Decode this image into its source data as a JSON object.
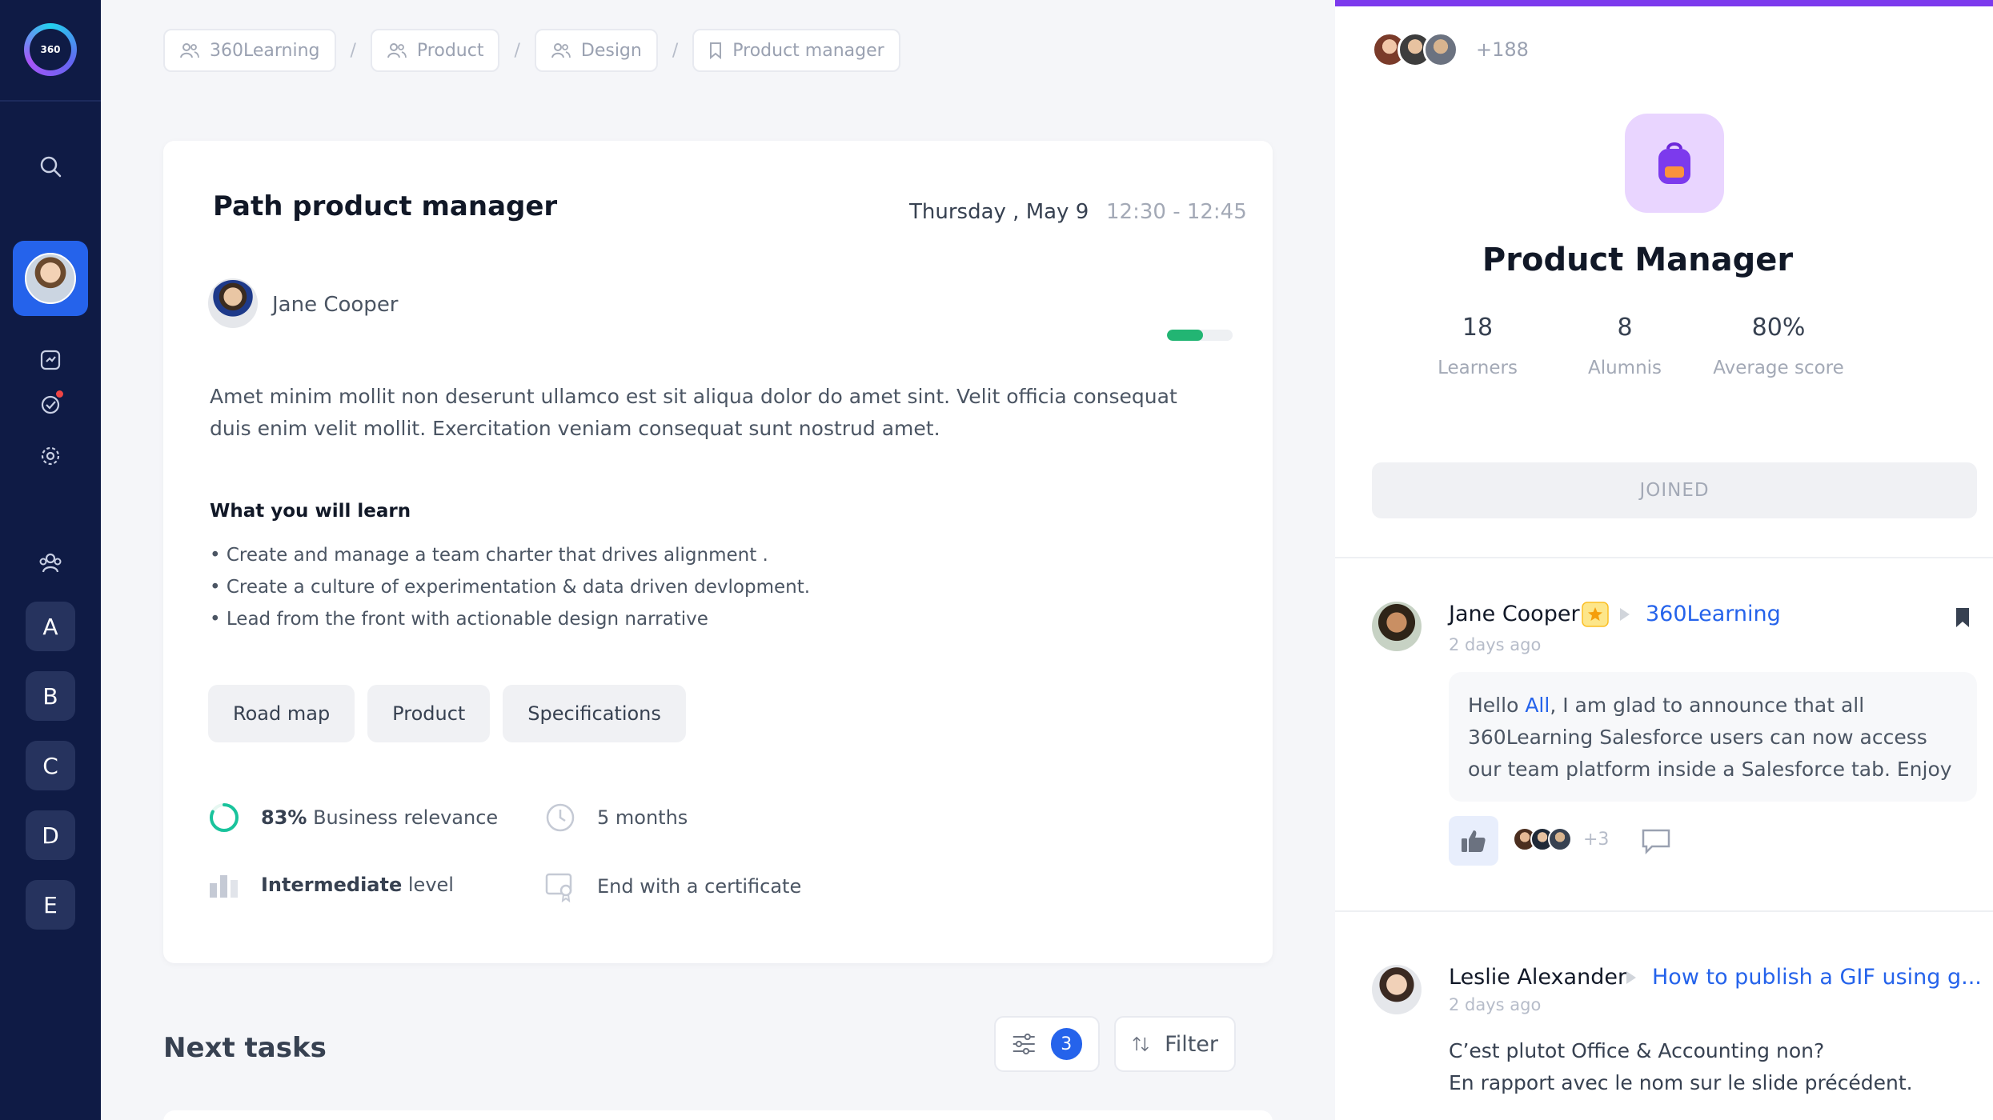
{
  "sidebar": {
    "logo_text": "360",
    "letters": [
      "A",
      "B",
      "C",
      "D",
      "E"
    ]
  },
  "breadcrumb": [
    "360Learning",
    "Product",
    "Design",
    "Product manager"
  ],
  "card": {
    "title": "Path product manager",
    "date": "Thursday , May 9",
    "time": "12:30 - 12:45",
    "author": "Jane Cooper",
    "progress": 0.55,
    "description": "Amet minim mollit non deserunt ullamco est sit aliqua dolor do amet sint. Velit officia consequat duis enim velit mollit. Exercitation veniam consequat sunt nostrud amet.",
    "learn_title": "What you will learn",
    "learn_items": [
      "• Create and manage a team charter that drives alignment .",
      "• Create a culture of experimentation & data driven devlopment.",
      "• Lead from the front with actionable design narrative"
    ],
    "tags": [
      "Road map",
      "Product",
      "Specifications"
    ],
    "relevance_value": "83%",
    "relevance_label": "Business relevance",
    "duration": "5 months",
    "level_value": "Intermediate",
    "level_label": "level",
    "certificate": "End with a certificate"
  },
  "tasks": {
    "title": "Next tasks",
    "filter_count": "3",
    "filter_label": "Filter"
  },
  "panel": {
    "accent": "#7c3aed",
    "members_count": "+188",
    "title": "Product Manager",
    "stats": [
      {
        "value": "18",
        "label": "Learners"
      },
      {
        "value": "8",
        "label": "Alumnis"
      },
      {
        "value": "80%",
        "label": "Average score"
      }
    ],
    "joined_label": "JOINED",
    "comments": [
      {
        "author": "Jane Cooper",
        "group": "360Learning",
        "time": "2 days ago",
        "text_prefix": "Hello ",
        "mention": "All",
        "text": ", I am glad to announce that all 360Learning Salesforce users can now access our team platform inside a Salesforce tab. Enjoy",
        "react_count": "+3"
      },
      {
        "author": "Leslie Alexander",
        "topic": "How to publish a GIF using g...",
        "time": "2 days ago",
        "line1": "C’est plutot Office & Accounting non?",
        "line2": "En rapport avec le nom sur le slide précédent."
      }
    ]
  }
}
